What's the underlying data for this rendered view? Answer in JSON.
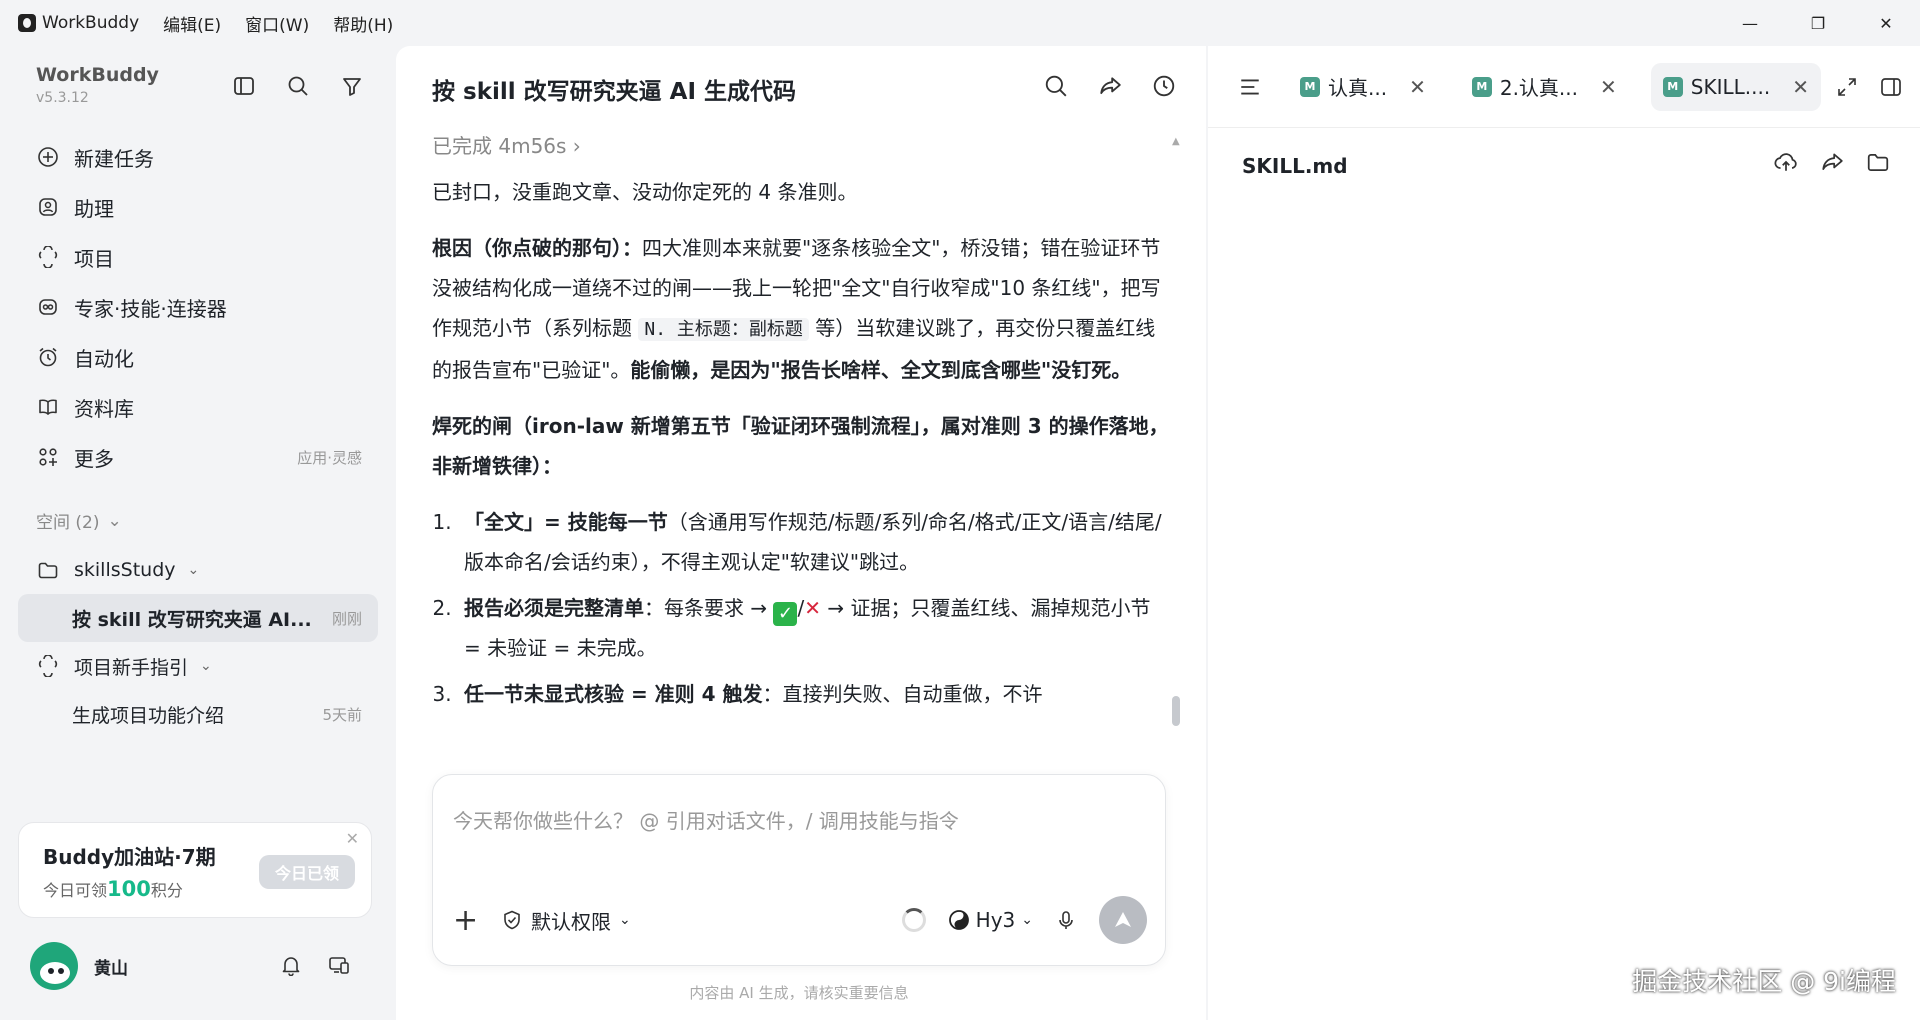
{
  "titlebar": {
    "app_name": "WorkBuddy",
    "menus": [
      "编辑(E)",
      "窗口(W)",
      "帮助(H)"
    ],
    "minimize": "—",
    "maximize": "❐",
    "close": "✕"
  },
  "sidebar": {
    "title": "WorkBuddy",
    "version": "v5.3.12",
    "nav": [
      {
        "label": "新建任务"
      },
      {
        "label": "助理"
      },
      {
        "label": "项目"
      },
      {
        "label": "专家·技能·连接器"
      },
      {
        "label": "自动化"
      },
      {
        "label": "资料库"
      },
      {
        "label": "更多",
        "extra": "应用·灵感"
      }
    ],
    "space_label": "空间 (2)",
    "tree": {
      "folder1": "skillsStudy",
      "task_active": "按 skill 改写研究夹逼 AI...",
      "task_active_time": "刚刚",
      "folder2": "项目新手指引",
      "task2": "生成项目功能介绍",
      "task2_time": "5天前"
    },
    "promo": {
      "title": "Buddy加油站·7期",
      "sub_prefix": "今日可领",
      "points": "100",
      "sub_suffix": "积分",
      "button": "今日已领"
    },
    "user_name": "黄山"
  },
  "chat": {
    "title": "按 skill 改写研究夹逼 AI 生成代码",
    "done_label": "已完成 4m56s",
    "p1": "已封口，没重跑文章、没动你定死的 4 条准则。",
    "p2_bold": "根因（你点破的那句）：",
    "p2_a": "四大准则本来就要\"逐条核验全文\"，桥没错；错在验证环节没被结构化成一道绕不过的闸——我上一轮把\"全文\"自行收窄成\"10 条红线\"，把写作规范小节（系列标题 ",
    "p2_code": "N. 主标题：副标题",
    "p2_b": " 等）当软建议跳了，再交份只覆盖红线的报告宣布\"已验证\"。",
    "p2_bold2": "能偷懒，是因为\"报告长啥样、全文到底含哪些\"没钉死。",
    "p3_bold": "焊死的闸（iron-law 新增第五节「验证闭环强制流程」，属对准则 3 的操作落地，非新增铁律）：",
    "li1_bold": "「全文」= 技能每一节",
    "li1": "（含通用写作规范/标题/系列/命名/格式/正文/语言/结尾/版本命名/会话约束），不得主观认定\"软建议\"跳过。",
    "li2_bold": "报告必须是完整清单",
    "li2_a": "：每条要求 → ",
    "li2_slash": "/",
    "li2_b": " → 证据；只覆盖红线、漏掉规范小节 = 未验证 = 未完成。",
    "li3_bold": "任一节未显式核验 = 准则 4 触发",
    "li3": "：直接判失败、自动重做，不许",
    "input_placeholder": "今天帮你做些什么？ @ 引用对话文件，/ 调用技能与指令",
    "permission": "默认权限",
    "model": "Hy3",
    "disclaimer": "内容由 AI 生成，请核实重要信息"
  },
  "right_panel": {
    "tabs": [
      {
        "label": "认真..."
      },
      {
        "label": "2.认真..."
      },
      {
        "label": "SKILL...."
      }
    ],
    "md_badge": "M",
    "file_name": "SKILL.md",
    "watermark": "掘金技术社区 @ 9i编程"
  },
  "colors": {
    "accent_green": "#16b98a",
    "md_badge": "#4a9e8a",
    "active_item_bg": "#e4e6ea"
  }
}
